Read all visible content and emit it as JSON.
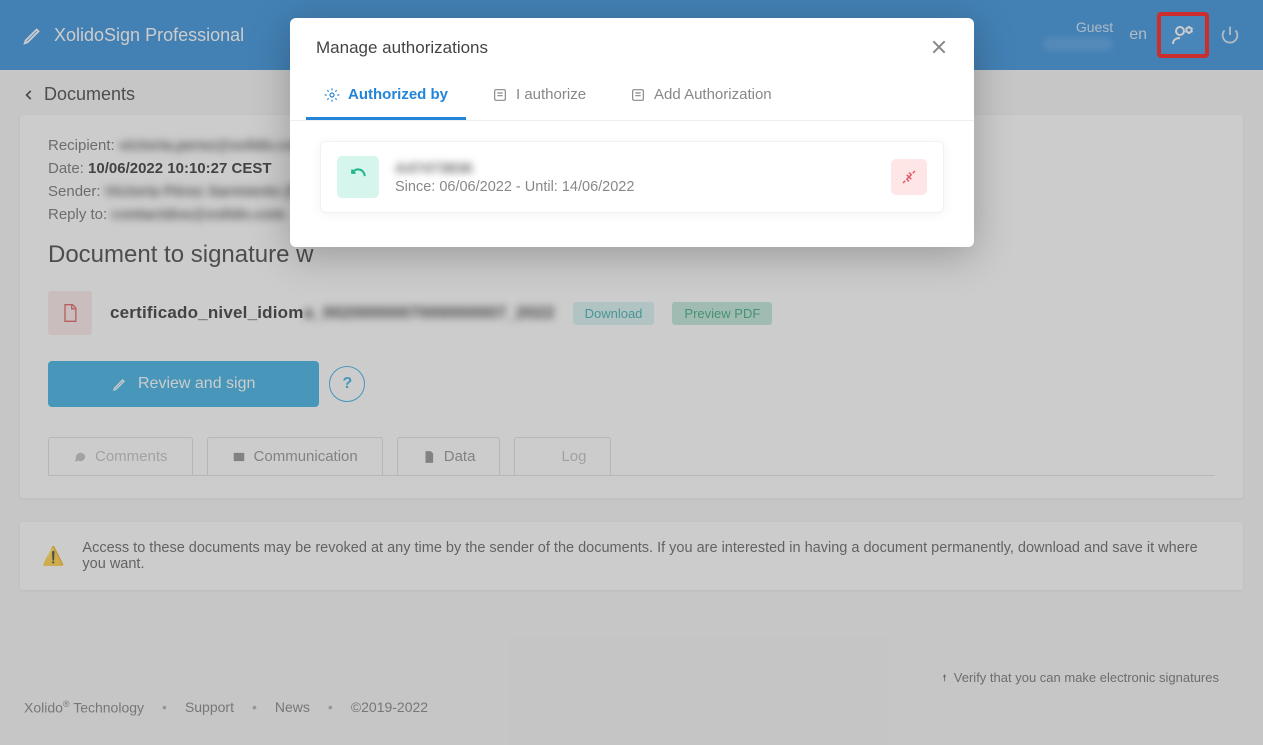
{
  "header": {
    "brand": "XolidoSign Professional",
    "guest": "Guest",
    "lang": "en"
  },
  "breadcrumb": {
    "label": "Documents"
  },
  "meta": {
    "recipient_label": "Recipient:",
    "recipient_value": "victoria.perez@xolido.com",
    "date_label": "Date:",
    "date_value": "10/06/2022 10:10:27 CEST",
    "sender_label": "Sender:",
    "sender_value": "Victoria Pérez Sarmiento [P5",
    "reply_label": "Reply to:",
    "reply_value": "contactdos@xolido.com"
  },
  "doc": {
    "heading": "Document to signature w",
    "filename_clear": "certificado_nivel_idiom",
    "filename_blur": "a_0020000007000000007_2022",
    "download": "Download",
    "preview": "Preview PDF"
  },
  "actions": {
    "review": "Review and sign",
    "help": "?"
  },
  "tabs": {
    "comments": "Comments",
    "communication": "Communication",
    "data": "Data",
    "log": "Log"
  },
  "warning": "Access to these documents may be revoked at any time by the sender of the documents. If you are interested in having a document permanently, download and save it where you want.",
  "verify": "Verify that you can make electronic signatures",
  "footer": {
    "company": "Xolido",
    "tech": " Technology",
    "support": "Support",
    "news": "News",
    "copyright": "©2019-2022"
  },
  "modal": {
    "title": "Manage authorizations",
    "tab_by": "Authorized by",
    "tab_i": "I authorize",
    "tab_add": "Add Authorization",
    "entry": {
      "name": "A47473836",
      "dates": "Since: 06/06/2022 - Until: 14/06/2022"
    }
  }
}
